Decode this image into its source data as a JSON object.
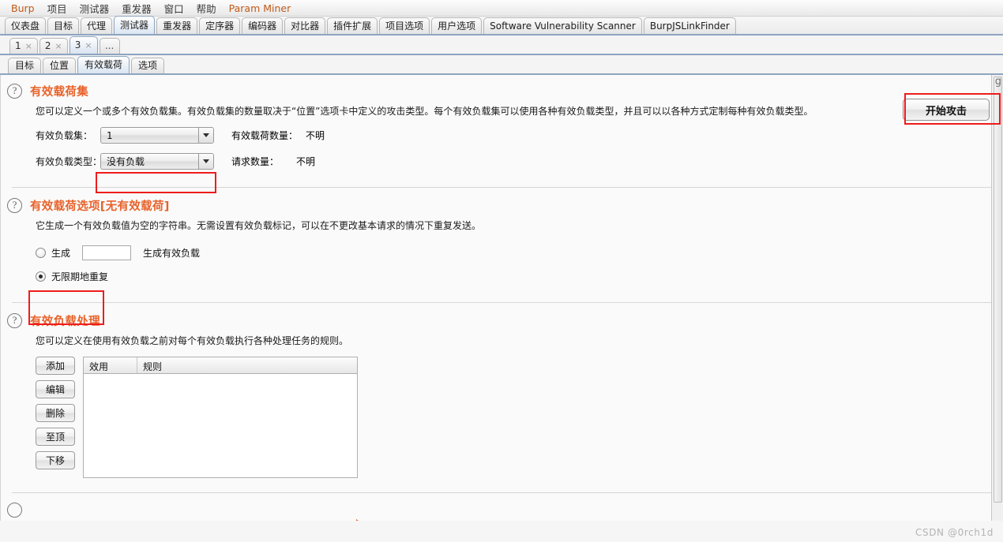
{
  "menubar": {
    "items": [
      {
        "label": "Burp",
        "accent": true
      },
      {
        "label": "项目",
        "accent": false
      },
      {
        "label": "测试器",
        "accent": false
      },
      {
        "label": "重发器",
        "accent": false
      },
      {
        "label": "窗口",
        "accent": false
      },
      {
        "label": "帮助",
        "accent": false
      },
      {
        "label": "Param Miner",
        "accent": true
      }
    ]
  },
  "top_tabs": [
    {
      "label": "仪表盘",
      "selected": false
    },
    {
      "label": "目标",
      "selected": false
    },
    {
      "label": "代理",
      "selected": false
    },
    {
      "label": "测试器",
      "selected": true
    },
    {
      "label": "重发器",
      "selected": false
    },
    {
      "label": "定序器",
      "selected": false
    },
    {
      "label": "编码器",
      "selected": false
    },
    {
      "label": "对比器",
      "selected": false
    },
    {
      "label": "插件扩展",
      "selected": false
    },
    {
      "label": "项目选项",
      "selected": false
    },
    {
      "label": "用户选项",
      "selected": false
    },
    {
      "label": "Software Vulnerability Scanner",
      "selected": false
    },
    {
      "label": "BurpJSLinkFinder",
      "selected": false
    }
  ],
  "attack_tabs": [
    {
      "label": "1",
      "close": "×",
      "selected": false
    },
    {
      "label": "2",
      "close": "×",
      "selected": false
    },
    {
      "label": "3",
      "close": "×",
      "selected": true
    },
    {
      "label": "...",
      "close": "",
      "selected": false
    }
  ],
  "inner_tabs": [
    {
      "label": "目标",
      "selected": false
    },
    {
      "label": "位置",
      "selected": false
    },
    {
      "label": "有效载荷",
      "selected": true
    },
    {
      "label": "选项",
      "selected": false
    }
  ],
  "start_attack_button": "开始攻击",
  "help_icon_glyph": "?",
  "sections": {
    "payload_sets": {
      "title": "有效载荷集",
      "description": "您可以定义一个或多个有效负载集。有效负载集的数量取决于“位置”选项卡中定义的攻击类型。每个有效负载集可以使用各种有效负载类型，并且可以以各种方式定制每种有效负载类型。",
      "set_label": "有效负载集：",
      "set_value": "1",
      "count_label": "有效载荷数量：",
      "count_value": "不明",
      "type_label": "有效负载类型：",
      "type_value": "没有负载",
      "requests_label": "请求数量：",
      "requests_value": "不明"
    },
    "payload_options": {
      "title": "有效载荷选项[无有效载荷]",
      "description": "它生成一个有效负载值为空的字符串。无需设置有效负载标记，可以在不更改基本请求的情况下重复发送。",
      "generate_radio_label": "生成",
      "generate_input_value": "",
      "generate_suffix_label": "生成有效负载",
      "generate_selected": false,
      "repeat_radio_label": "无限期地重复",
      "repeat_selected": true
    },
    "payload_processing": {
      "title": "有效负载处理",
      "description": "您可以定义在使用有效负载之前对每个有效负载执行各种处理任务的规则。",
      "buttons": [
        "添加",
        "编辑",
        "删除",
        "至顶",
        "下移"
      ],
      "table": {
        "columns": [
          "效用",
          "规则"
        ],
        "rows": []
      }
    }
  },
  "watermark": "CSDN @0rch1d",
  "stray_char": "g",
  "colors": {
    "section_title": "#e8622a",
    "annotation_red": "#ee1c1c",
    "tab_selected": "#dbe6f2",
    "expander_arrow": "#f2622a"
  }
}
